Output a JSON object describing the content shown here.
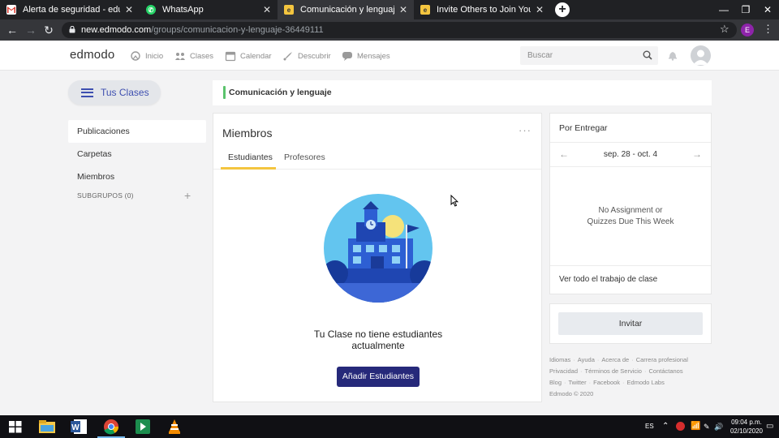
{
  "browser": {
    "tabs": [
      {
        "title": "Alerta de seguridad - educapren",
        "icon": "gmail-icon"
      },
      {
        "title": "WhatsApp",
        "icon": "whatsapp-icon"
      },
      {
        "title": "Comunicación y lenguaje | Edmo",
        "icon": "edmodo-icon"
      },
      {
        "title": "Invite Others to Join Your Class/",
        "icon": "edmodo-icon"
      }
    ],
    "active_tab": 2,
    "url_host": "new.edmodo.com",
    "url_path": "/groups/comunicacion-y-lenguaje-36449111",
    "profile_initial": "E"
  },
  "header": {
    "logo": "edmodo",
    "nav": [
      {
        "label": "Inicio",
        "icon": "home-icon"
      },
      {
        "label": "Clases",
        "icon": "classes-icon"
      },
      {
        "label": "Calendar",
        "icon": "calendar-icon"
      },
      {
        "label": "Descubrir",
        "icon": "discover-icon"
      },
      {
        "label": "Mensajes",
        "icon": "messages-icon"
      }
    ],
    "search_placeholder": "Buscar"
  },
  "sidebar": {
    "classes_button": "Tus Clases",
    "items": [
      {
        "label": "Publicaciones",
        "active": true
      },
      {
        "label": "Carpetas",
        "active": false
      },
      {
        "label": "Miembros",
        "active": false
      }
    ],
    "subgroups_label": "SUBGRUPOS (0)"
  },
  "class_title": "Comunicación y lenguaje",
  "members": {
    "title": "Miembros",
    "tabs": [
      "Estudiantes",
      "Profesores"
    ],
    "active_tab": 0,
    "empty_text": "Tu Clase no tiene estudiantes actualmente",
    "add_button": "Añadir Estudiantes"
  },
  "pending": {
    "title": "Por Entregar",
    "date_range": "sep. 28 - oct. 4",
    "empty_line1": "No Assignment or",
    "empty_line2": "Quizzes Due This Week",
    "view_all": "Ver todo el trabajo de clase"
  },
  "invite": {
    "button": "Invitar"
  },
  "footer": {
    "links_row1": [
      "Idiomas",
      "Ayuda",
      "Acerca de",
      "Carrera profesional"
    ],
    "links_row2": [
      "Privacidad",
      "Términos de Servicio",
      "Contáctanos"
    ],
    "links_row3": [
      "Blog",
      "Twitter",
      "Facebook",
      "Edmodo Labs"
    ],
    "copyright": "Edmodo © 2020"
  },
  "taskbar": {
    "language": "ES",
    "time": "09:04 p.m.",
    "date": "02/10/2020"
  },
  "colors": {
    "accent_green": "#5bc36c",
    "primary_navy": "#26297a",
    "tab_underline": "#f4c53f",
    "link_blue": "#3e4fb0"
  }
}
